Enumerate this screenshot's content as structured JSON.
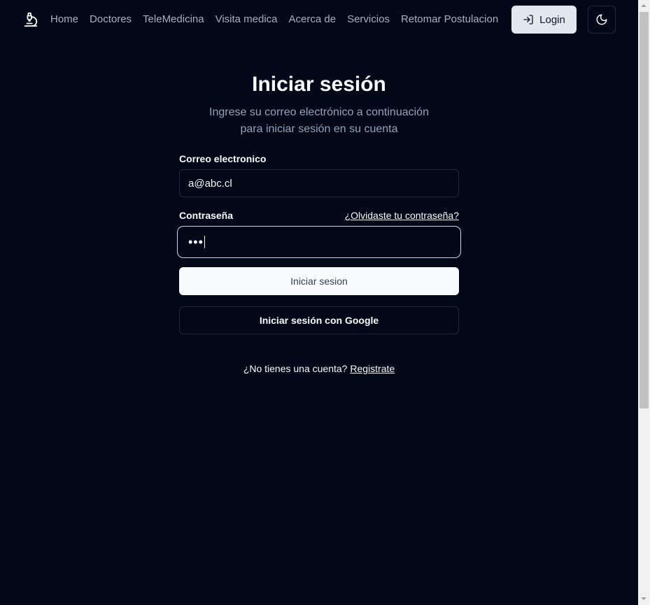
{
  "nav": {
    "logo_icon": "microscope-icon",
    "links": [
      "Home",
      "Doctores",
      "TeleMedicina",
      "Visita medica",
      "Acerca de",
      "Servicios",
      "Retomar Postulacion"
    ],
    "login_label": "Login",
    "login_icon": "log-in-icon",
    "theme_icon": "moon-icon"
  },
  "login": {
    "title": "Iniciar sesión",
    "subtitle_line1": "Ingrese su correo electrónico a continuación",
    "subtitle_line2": "para iniciar sesión en su cuenta",
    "email_label": "Correo electronico",
    "email_value": "a@abc.cl",
    "password_label": "Contraseña",
    "forgot_link": "¿Olvidaste tu contraseña?",
    "password_value": "•••",
    "submit_label": "Iniciar sesion",
    "google_label": "Iniciar sesión con Google",
    "no_account_text": "¿No tienes una cuenta?",
    "register_link": "Registrate"
  },
  "colors": {
    "background": "#020817",
    "foreground": "#f8fafc",
    "muted": "#94a3b8",
    "border": "#1e293b"
  }
}
